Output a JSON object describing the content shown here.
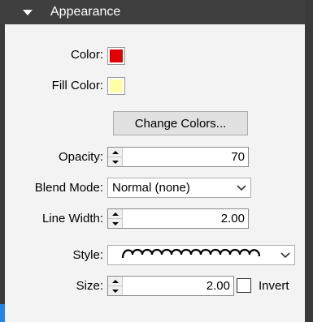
{
  "section": {
    "title": "Appearance"
  },
  "fields": {
    "color_label": "Color:",
    "fill_color_label": "Fill Color:",
    "change_colors_label": "Change Colors...",
    "opacity_label": "Opacity:",
    "opacity_value": "70",
    "blend_mode_label": "Blend Mode:",
    "blend_mode_value": "Normal (none)",
    "line_width_label": "Line Width:",
    "line_width_value": "2.00",
    "style_label": "Style:",
    "size_label": "Size:",
    "size_value": "2.00",
    "invert_label": "Invert"
  },
  "colors": {
    "stroke": "#e00000",
    "fill": "#ffffa8",
    "header_bg": "#3f3f3f",
    "panel_bg": "#f3f3f3",
    "accent": "#1f86e8"
  },
  "icons": {
    "section_toggle": "triangle-down-icon",
    "spinner": "spin-arrows-icon",
    "dropdown": "chevron-down-icon",
    "style_preview": "cloudy-stroke-icon"
  }
}
